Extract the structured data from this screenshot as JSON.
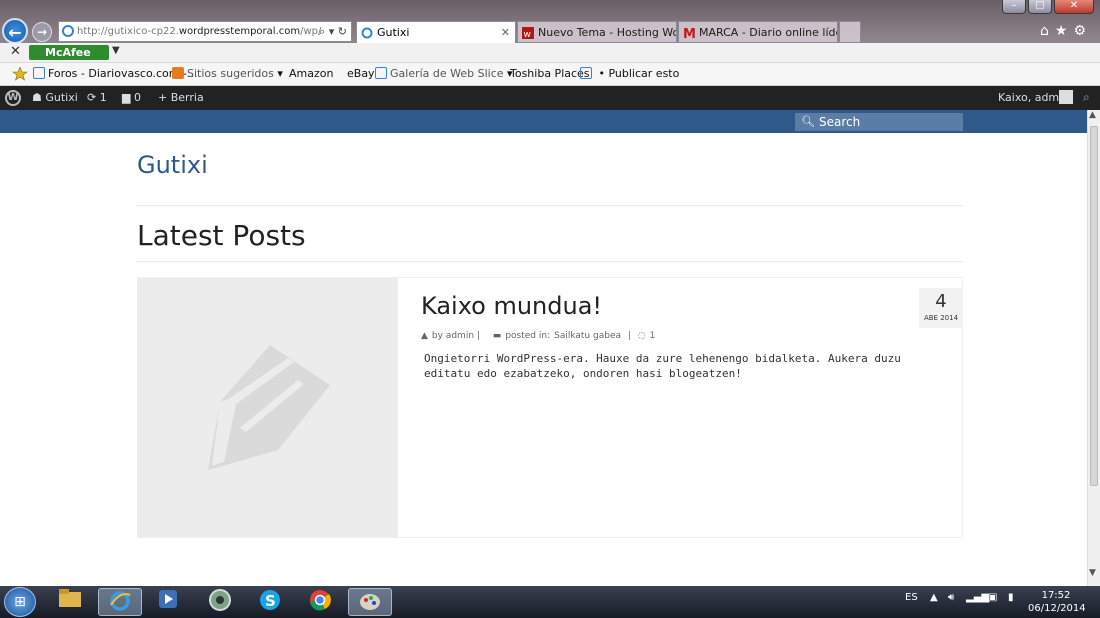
{
  "browser": {
    "address": {
      "prefix": "http://gutixico-cp22.",
      "host": "wordpresstemporal.com",
      "suffix": "/wp/"
    },
    "tabs": [
      {
        "label": "Gutixi"
      },
      {
        "label": "Nuevo Tema - Hosting WordP..."
      },
      {
        "label": "MARCA - Diario online líder en..."
      }
    ],
    "toolbar_addon": "McAfee",
    "favorites": [
      {
        "label": "Foros - Diariovasco.com -..."
      },
      {
        "label": "Sitios sugeridos"
      },
      {
        "label": "Amazon"
      },
      {
        "label": "eBay"
      },
      {
        "label": "Galería de Web Slice"
      },
      {
        "label": "Toshiba Places"
      },
      {
        "label": "Publicar esto"
      }
    ]
  },
  "adminbar": {
    "site_name": "Gutixi",
    "updates_count": "1",
    "comments_count": "0",
    "new_label": "Berria",
    "account_label": "Kaixo, admin"
  },
  "site": {
    "search_placeholder": "Search",
    "title": "Gutixi",
    "page_heading": "Latest Posts"
  },
  "post": {
    "title": "Kaixo mundua!",
    "author": "by admin |",
    "category_prefix": "posted in:",
    "category": "Sailkatu gabea",
    "comments": "1",
    "excerpt": "Ongietorri WordPress-era. Hauxe da zure lehenengo bidalketa. Aukera duzu editatu edo ezabatzeko, ondoren hasi blogeatzen!",
    "date_day": "4",
    "date_month": "ABE 2014"
  },
  "taskbar": {
    "language": "ES",
    "time": "17:52",
    "date": "06/12/2014"
  },
  "colors": {
    "brand": "#30598b",
    "adminbar": "#222222"
  }
}
